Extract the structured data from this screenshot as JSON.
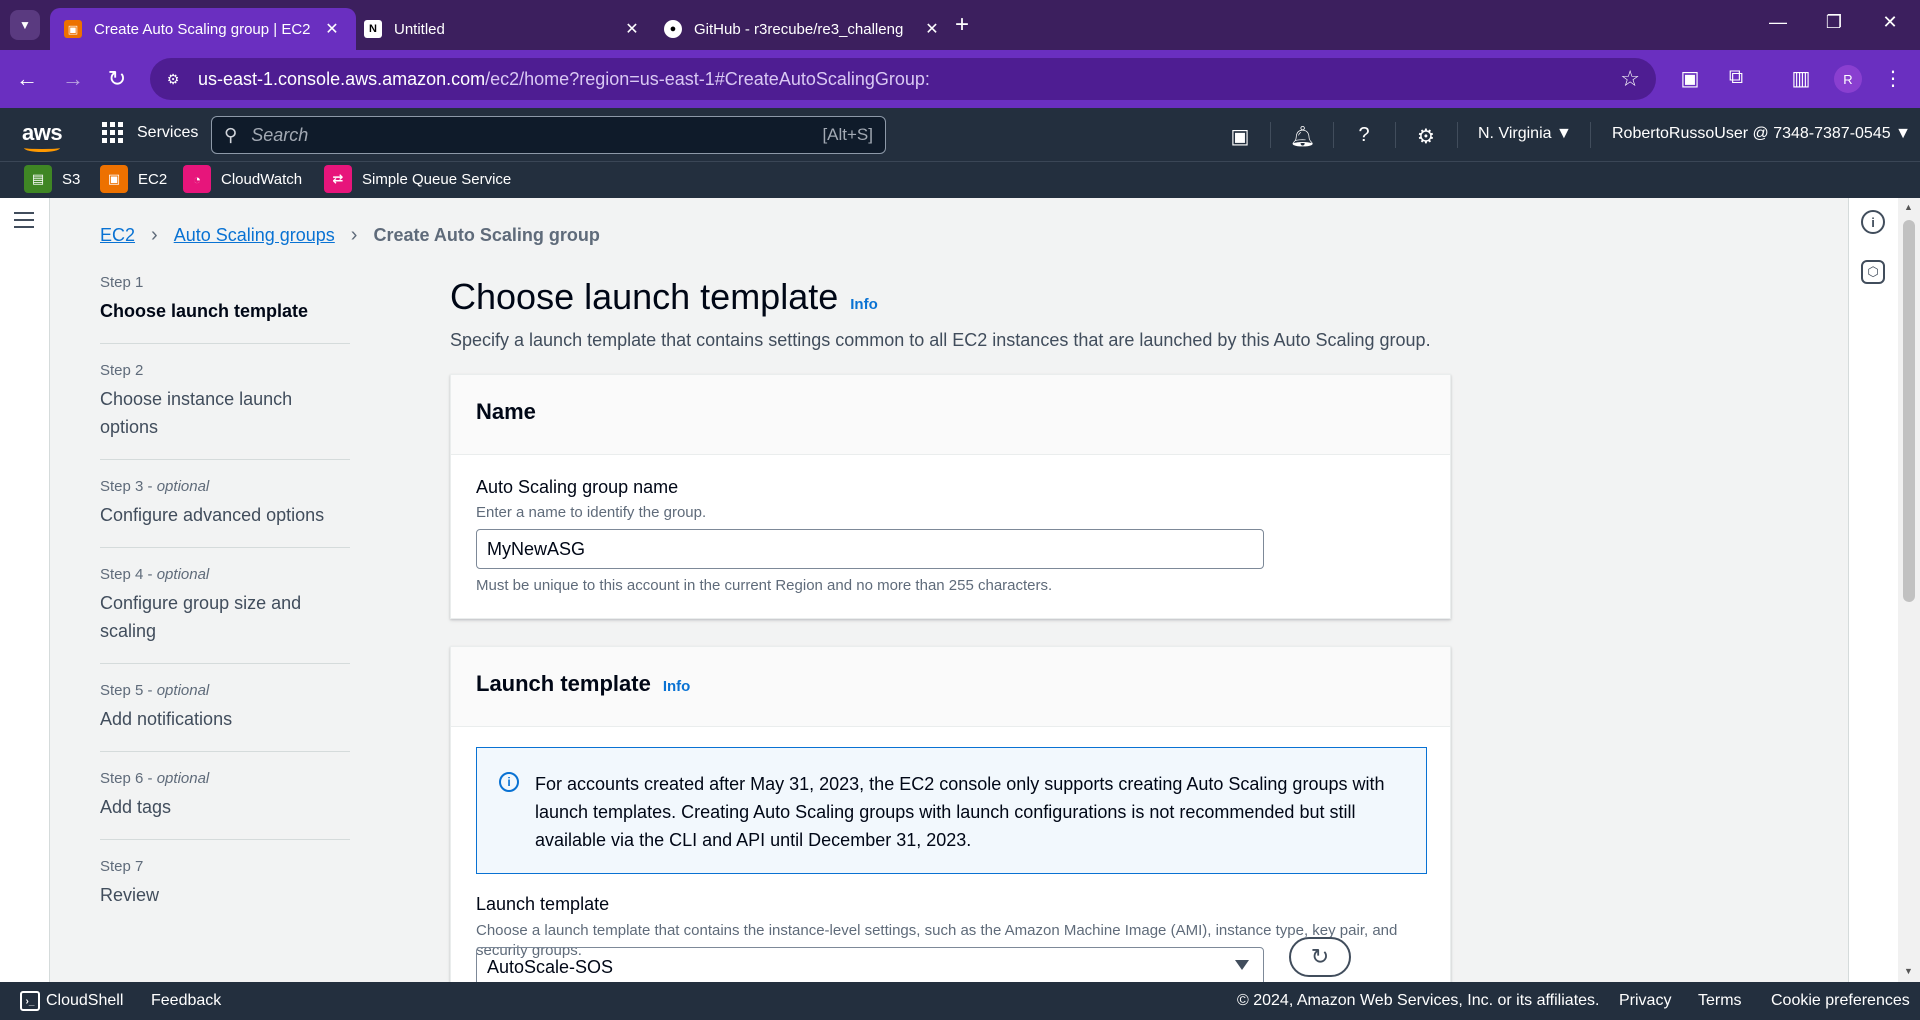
{
  "browser": {
    "tabs": [
      {
        "title": "Create Auto Scaling group | EC2",
        "icon": "aws-ec2-favicon",
        "active": true
      },
      {
        "title": "Untitled",
        "icon": "notion-favicon",
        "active": false
      },
      {
        "title": "GitHub - r3recube/re3_challeng",
        "icon": "github-favicon",
        "active": false
      }
    ],
    "url_host": "us-east-1.console.aws.amazon.com",
    "url_path": "/ec2/home?region=us-east-1#CreateAutoScalingGroup:",
    "profile_initial": "R"
  },
  "aws_nav": {
    "logo": "aws",
    "services_label": "Services",
    "search_placeholder": "Search",
    "search_shortcut": "[Alt+S]",
    "region": "N. Virginia",
    "account": "RobertoRussoUser @ 7348-7387-0545"
  },
  "favorites": [
    {
      "label": "S3",
      "color": "#3f8624"
    },
    {
      "label": "EC2",
      "color": "#ed7100"
    },
    {
      "label": "CloudWatch",
      "color": "#e7157b"
    },
    {
      "label": "Simple Queue Service",
      "color": "#e7157b"
    }
  ],
  "breadcrumb": {
    "items": [
      "EC2",
      "Auto Scaling groups"
    ],
    "current": "Create Auto Scaling group"
  },
  "steps": [
    {
      "num": "Step 1",
      "optional": "",
      "label": "Choose launch template",
      "active": true
    },
    {
      "num": "Step 2",
      "optional": "",
      "label": "Choose instance launch options",
      "active": false
    },
    {
      "num": "Step 3",
      "optional": "optional",
      "label": "Configure advanced options",
      "active": false
    },
    {
      "num": "Step 4",
      "optional": "optional",
      "label": "Configure group size and scaling",
      "active": false
    },
    {
      "num": "Step 5",
      "optional": "optional",
      "label": "Add notifications",
      "active": false
    },
    {
      "num": "Step 6",
      "optional": "optional",
      "label": "Add tags",
      "active": false
    },
    {
      "num": "Step 7",
      "optional": "",
      "label": "Review",
      "active": false
    }
  ],
  "main": {
    "title": "Choose launch template",
    "info": "Info",
    "description": "Specify a launch template that contains settings common to all EC2 instances that are launched by this Auto Scaling group.",
    "name_panel": {
      "heading": "Name",
      "field_label": "Auto Scaling group name",
      "field_desc": "Enter a name to identify the group.",
      "field_value": "MyNewASG",
      "field_hint": "Must be unique to this account in the current Region and no more than 255 characters."
    },
    "lt_panel": {
      "heading": "Launch template",
      "info": "Info",
      "alert": "For accounts created after May 31, 2023, the EC2 console only supports creating Auto Scaling groups with launch templates. Creating Auto Scaling groups with launch configurations is not recommended but still available via the CLI and API until December 31, 2023.",
      "field_label": "Launch template",
      "field_desc": "Choose a launch template that contains the instance-level settings, such as the Amazon Machine Image (AMI), instance type, key pair, and security groups.",
      "selected": "AutoScale-SOS"
    }
  },
  "footer": {
    "cloudshell": "CloudShell",
    "feedback": "Feedback",
    "copyright": "© 2024, Amazon Web Services, Inc. or its affiliates.",
    "privacy": "Privacy",
    "terms": "Terms",
    "cookies": "Cookie preferences"
  }
}
